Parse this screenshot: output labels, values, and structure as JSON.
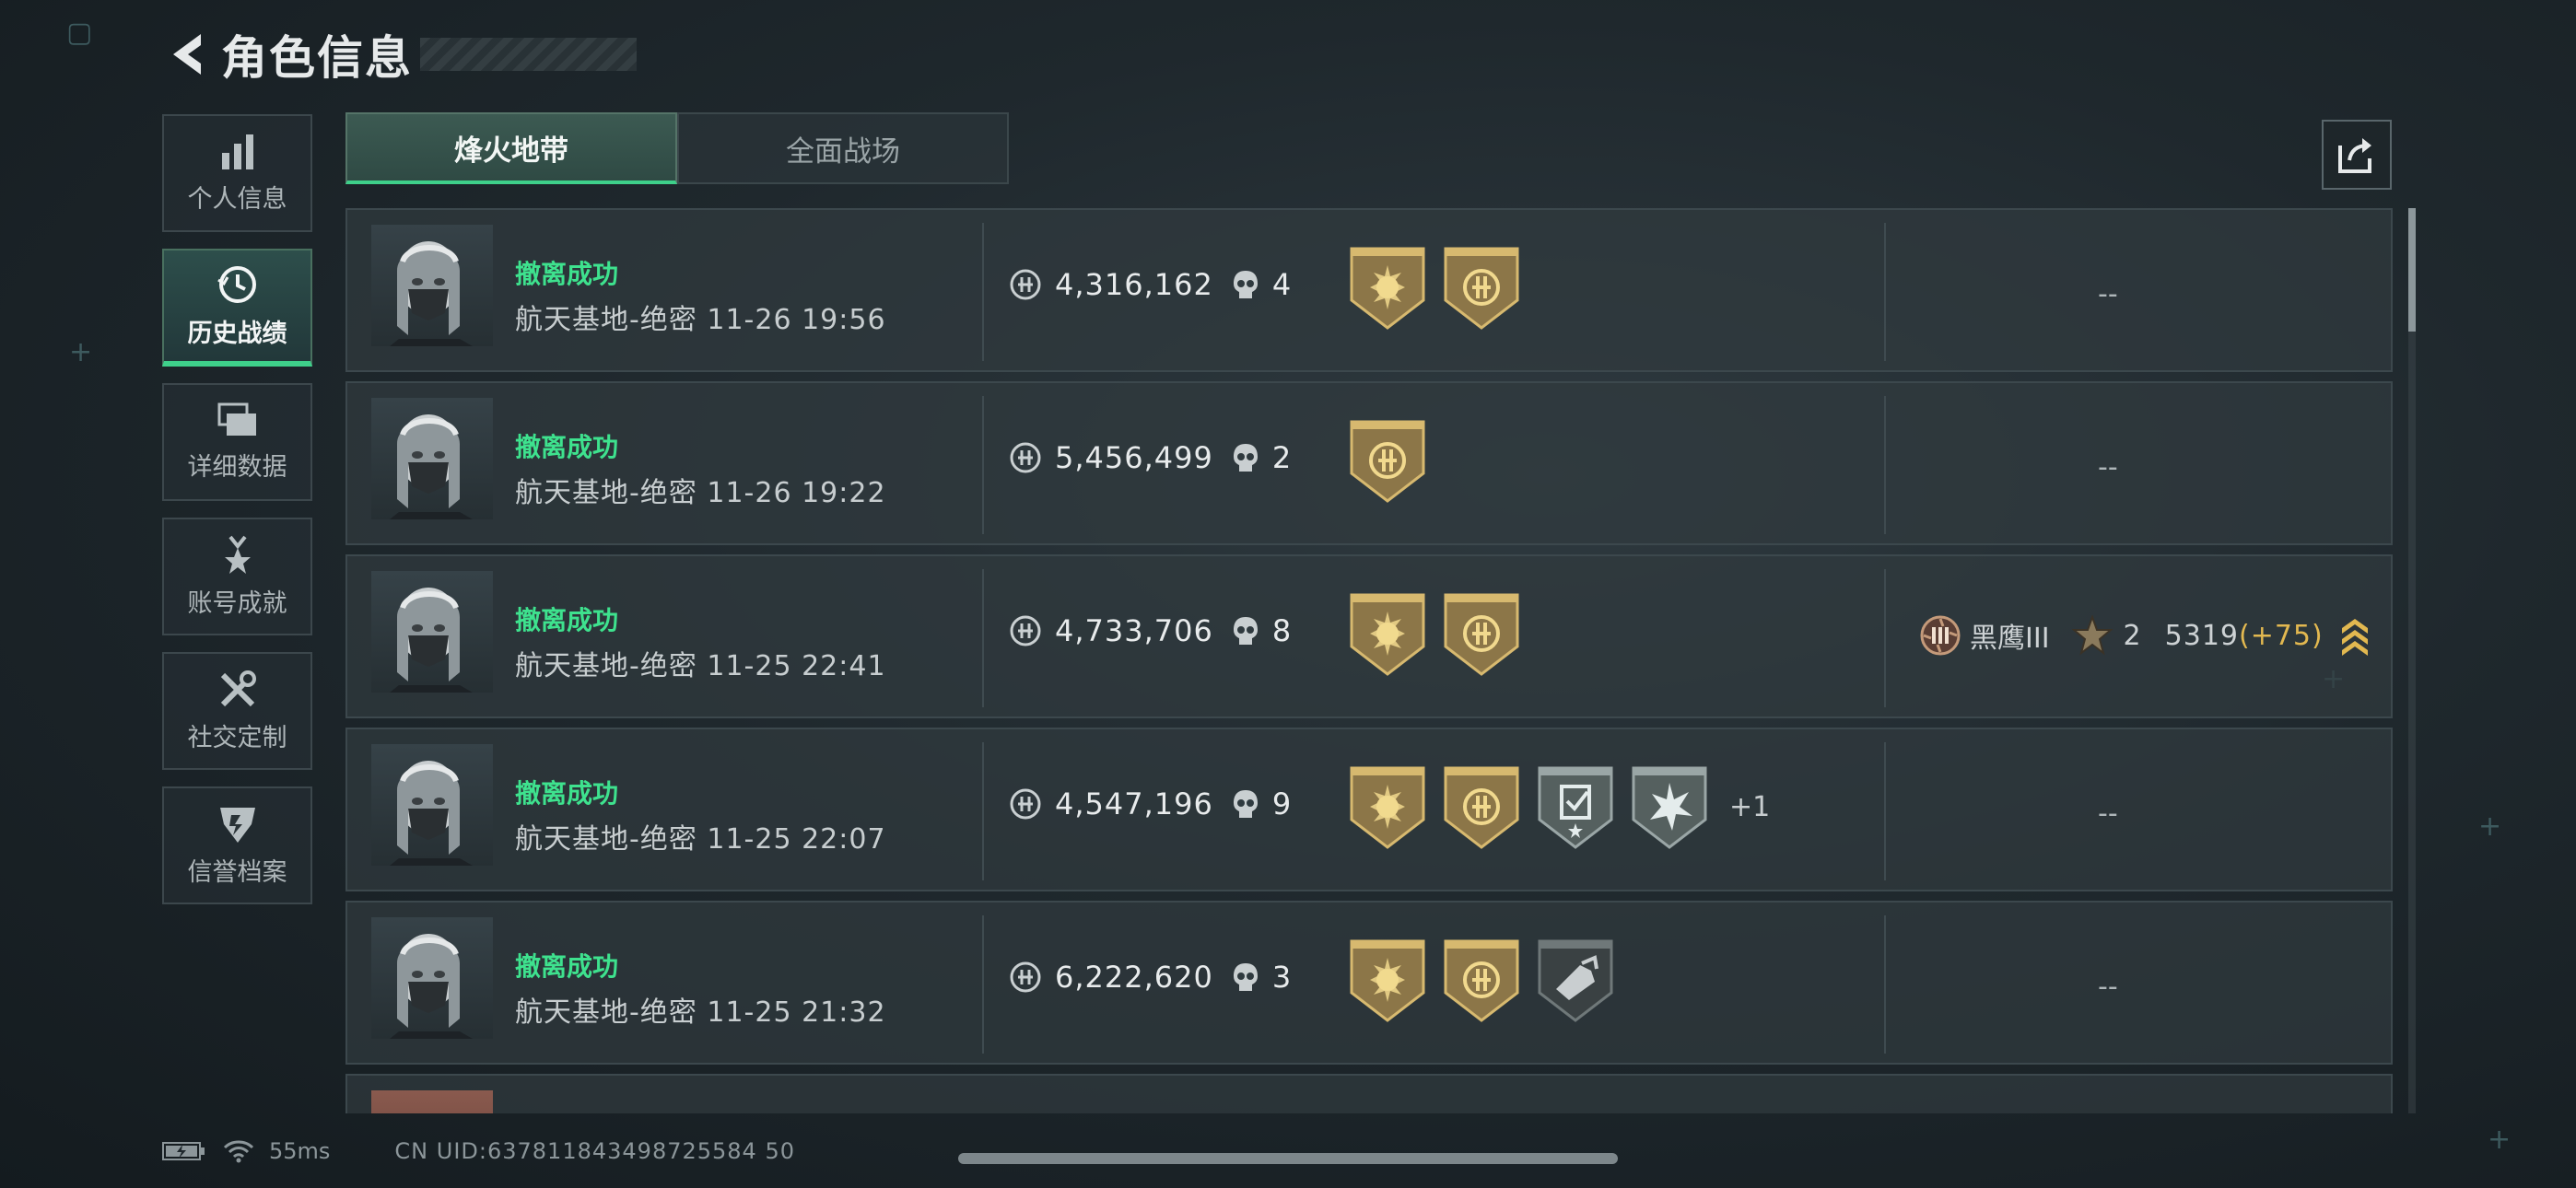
{
  "header": {
    "title": "角色信息"
  },
  "sidebar": {
    "items": [
      {
        "label": "个人信息",
        "icon": "bar-chart-icon",
        "active": false
      },
      {
        "label": "历史战绩",
        "icon": "history-clock-icon",
        "active": true
      },
      {
        "label": "详细数据",
        "icon": "data-cards-icon",
        "active": false
      },
      {
        "label": "账号成就",
        "icon": "medal-icon",
        "active": false
      },
      {
        "label": "社交定制",
        "icon": "tools-icon",
        "active": false
      },
      {
        "label": "信誉档案",
        "icon": "credit-shield-icon",
        "active": false
      }
    ]
  },
  "tabs": [
    {
      "label": "烽火地带",
      "active": true
    },
    {
      "label": "全面战场",
      "active": false
    }
  ],
  "records": [
    {
      "status": "撤离成功",
      "map_time": "航天基地-绝密 11-26 19:56",
      "value": "4,316,162",
      "kills": "4",
      "badges": [
        "gold-sun-badge",
        "gold-emblem-badge"
      ],
      "extra": "",
      "right": "--"
    },
    {
      "status": "撤离成功",
      "map_time": "航天基地-绝密 11-26 19:22",
      "value": "5,456,499",
      "kills": "2",
      "badges": [
        "gold-emblem-badge"
      ],
      "extra": "",
      "right": "--"
    },
    {
      "status": "撤离成功",
      "map_time": "航天基地-绝密 11-25 22:41",
      "value": "4,733,706",
      "kills": "8",
      "badges": [
        "gold-sun-badge",
        "gold-emblem-badge"
      ],
      "extra": "",
      "right": "",
      "rank": {
        "name": "黑鹰III",
        "stars": "2",
        "score": "5319",
        "delta": "(+75)"
      }
    },
    {
      "status": "撤离成功",
      "map_time": "航天基地-绝密 11-25 22:07",
      "value": "4,547,196",
      "kills": "9",
      "badges": [
        "gold-sun-badge",
        "gold-emblem-badge",
        "silver-clipboard-badge",
        "silver-burst-badge"
      ],
      "extra": "+1",
      "right": "--"
    },
    {
      "status": "撤离成功",
      "map_time": "航天基地-绝密 11-25 21:32",
      "value": "6,222,620",
      "kills": "3",
      "badges": [
        "gold-sun-badge",
        "gold-emblem-badge",
        "dark-tool-badge"
      ],
      "extra": "",
      "right": "--"
    }
  ],
  "footer": {
    "ping": "55ms",
    "uid": "CN UID:637811843498725584 50"
  },
  "colors": {
    "accent": "#3ed08a",
    "status_success": "#3ee28e",
    "gold": "#c8a65a",
    "delta": "#e2b850"
  }
}
